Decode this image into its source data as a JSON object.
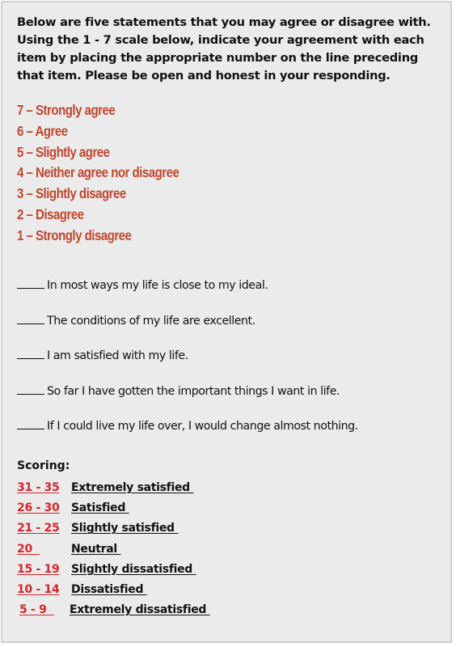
{
  "intro": "Below are five statements that you may agree or disagree with. Using the 1 - 7 scale below, indicate your agreement with each item by placing the appropriate number on the line preceding that item. Please be open and honest in your responding.",
  "scale": [
    "7 – Strongly agree",
    "6 – Agree",
    "5 – Slightly agree",
    "4 – Neither agree nor disagree",
    "3 – Slightly disagree",
    "2 – Disagree",
    "1 – Strongly disagree"
  ],
  "items": [
    "In most ways my life is close to my ideal.",
    "The conditions of my life are excellent.",
    "I am satisfied with my life.",
    "So far I have gotten the important things I want in life.",
    "If I could live my life over, I would change almost nothing."
  ],
  "scoring": {
    "title": "Scoring:",
    "rows": [
      {
        "range": "31 - 35",
        "label": "Extremely satisfied "
      },
      {
        "range": "26 - 30",
        "label": "Satisfied "
      },
      {
        "range": "21 - 25",
        "label": "Slightly satisfied "
      },
      {
        "range": "20  ",
        "label": "Neutral "
      },
      {
        "range": "15 - 19",
        "label": "Slightly dissatisfied "
      },
      {
        "range": "10 - 14",
        "label": "Dissatisfied "
      },
      {
        "range": "5 - 9  ",
        "label": "Extremely dissatisfied "
      }
    ]
  },
  "colors": {
    "scale_text": "#c0472f",
    "score_range": "#d7262b",
    "background": "#ebebeb"
  }
}
